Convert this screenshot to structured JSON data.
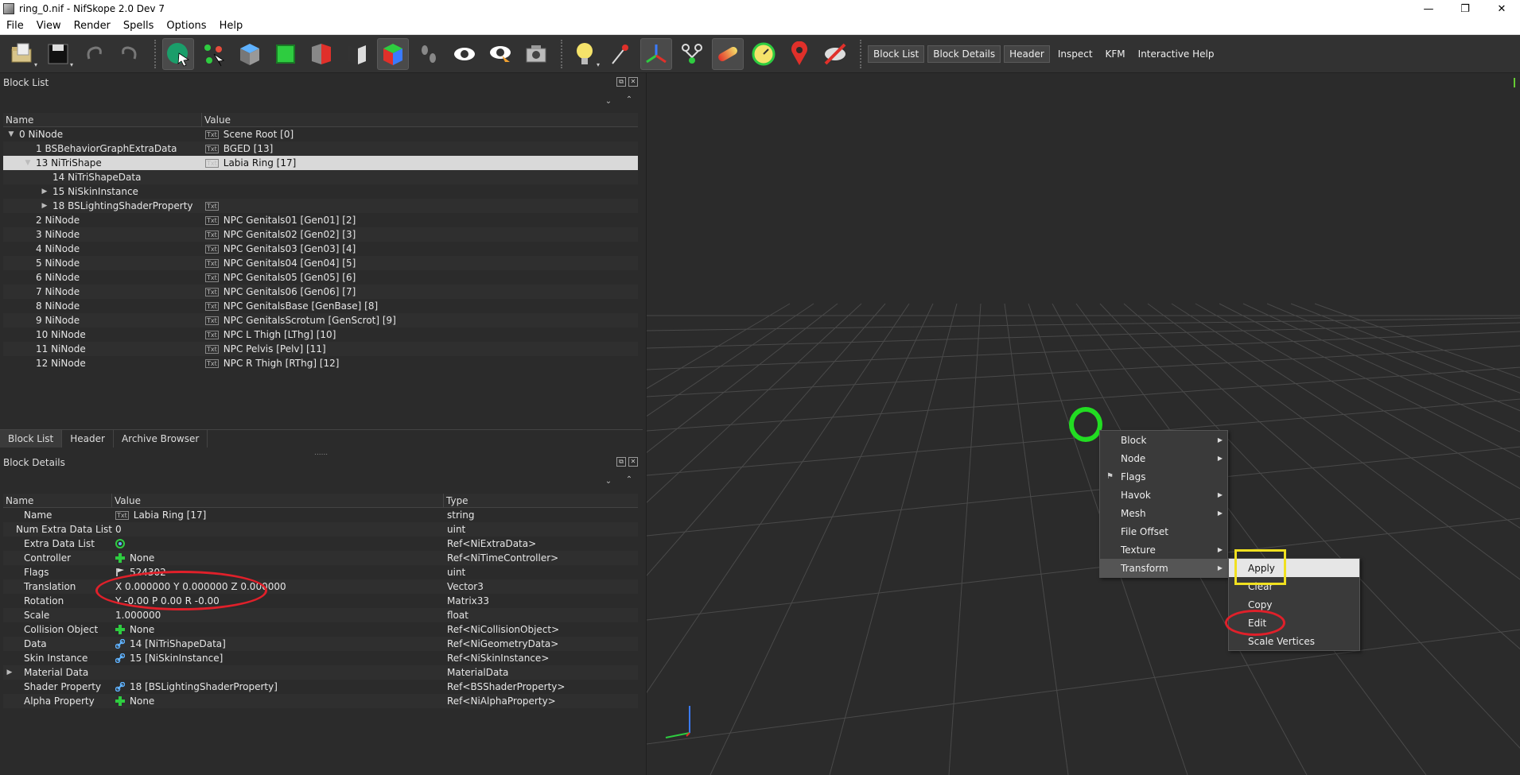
{
  "window": {
    "title": "ring_0.nif - NifSkope 2.0 Dev 7",
    "controls": [
      "—",
      "❐",
      "✕"
    ]
  },
  "menubar": [
    "File",
    "View",
    "Render",
    "Spells",
    "Options",
    "Help"
  ],
  "toolbar": {
    "text_buttons": [
      "Block List",
      "Block Details",
      "Header",
      "Inspect",
      "KFM",
      "Interactive Help"
    ]
  },
  "block_list": {
    "title": "Block List",
    "columns": [
      "Name",
      "Value"
    ],
    "rows": [
      {
        "indent": 0,
        "arrow": "▼",
        "name": "0 NiNode",
        "icon": "txt",
        "value": "Scene Root [0]"
      },
      {
        "indent": 1,
        "arrow": "",
        "name": "1 BSBehaviorGraphExtraData",
        "icon": "txt",
        "value": "BGED [13]"
      },
      {
        "indent": 1,
        "arrow": "▼",
        "name": "13 NiTriShape",
        "icon": "txt",
        "value": "Labia Ring [17]",
        "selected": true
      },
      {
        "indent": 2,
        "arrow": "",
        "name": "14 NiTriShapeData",
        "icon": "",
        "value": ""
      },
      {
        "indent": 2,
        "arrow": "▶",
        "name": "15 NiSkinInstance",
        "icon": "",
        "value": ""
      },
      {
        "indent": 2,
        "arrow": "▶",
        "name": "18 BSLightingShaderProperty",
        "icon": "txt",
        "value": ""
      },
      {
        "indent": 1,
        "arrow": "",
        "name": "2 NiNode",
        "icon": "txt",
        "value": "NPC Genitals01 [Gen01] [2]"
      },
      {
        "indent": 1,
        "arrow": "",
        "name": "3 NiNode",
        "icon": "txt",
        "value": "NPC Genitals02 [Gen02] [3]"
      },
      {
        "indent": 1,
        "arrow": "",
        "name": "4 NiNode",
        "icon": "txt",
        "value": "NPC Genitals03 [Gen03] [4]"
      },
      {
        "indent": 1,
        "arrow": "",
        "name": "5 NiNode",
        "icon": "txt",
        "value": "NPC Genitals04 [Gen04] [5]"
      },
      {
        "indent": 1,
        "arrow": "",
        "name": "6 NiNode",
        "icon": "txt",
        "value": "NPC Genitals05 [Gen05] [6]"
      },
      {
        "indent": 1,
        "arrow": "",
        "name": "7 NiNode",
        "icon": "txt",
        "value": "NPC Genitals06 [Gen06] [7]"
      },
      {
        "indent": 1,
        "arrow": "",
        "name": "8 NiNode",
        "icon": "txt",
        "value": "NPC GenitalsBase [GenBase] [8]"
      },
      {
        "indent": 1,
        "arrow": "",
        "name": "9 NiNode",
        "icon": "txt",
        "value": "NPC GenitalsScrotum [GenScrot] [9]"
      },
      {
        "indent": 1,
        "arrow": "",
        "name": "10 NiNode",
        "icon": "txt",
        "value": "NPC L Thigh [LThg] [10]"
      },
      {
        "indent": 1,
        "arrow": "",
        "name": "11 NiNode",
        "icon": "txt",
        "value": "NPC Pelvis [Pelv] [11]"
      },
      {
        "indent": 1,
        "arrow": "",
        "name": "12 NiNode",
        "icon": "txt",
        "value": "NPC R Thigh [RThg] [12]"
      }
    ]
  },
  "tabs": [
    "Block List",
    "Header",
    "Archive Browser"
  ],
  "block_details": {
    "title": "Block Details",
    "columns": [
      "Name",
      "Value",
      "Type"
    ],
    "rows": [
      {
        "arrow": "",
        "name": "Name",
        "icon": "txt",
        "value": "Labia Ring [17]",
        "type": "string"
      },
      {
        "arrow": "",
        "name": "Num Extra Data List",
        "icon": "",
        "value": "0",
        "type": "uint"
      },
      {
        "arrow": "",
        "name": "Extra Data List",
        "icon": "link-green",
        "value": "",
        "type": "Ref<NiExtraData>"
      },
      {
        "arrow": "",
        "name": "Controller",
        "icon": "plus",
        "value": "None",
        "type": "Ref<NiTimeController>"
      },
      {
        "arrow": "",
        "name": "Flags",
        "icon": "flag",
        "value": "524302",
        "type": "uint"
      },
      {
        "arrow": "",
        "name": "Translation",
        "icon": "",
        "value": "X 0.000000 Y 0.000000 Z 0.000000",
        "type": "Vector3"
      },
      {
        "arrow": "",
        "name": "Rotation",
        "icon": "",
        "value": "Y -0.00 P 0.00 R -0.00",
        "type": "Matrix33"
      },
      {
        "arrow": "",
        "name": "Scale",
        "icon": "",
        "value": "1.000000",
        "type": "float"
      },
      {
        "arrow": "",
        "name": "Collision Object",
        "icon": "plus",
        "value": "None",
        "type": "Ref<NiCollisionObject>"
      },
      {
        "arrow": "",
        "name": "Data",
        "icon": "link",
        "value": "14 [NiTriShapeData]",
        "type": "Ref<NiGeometryData>"
      },
      {
        "arrow": "",
        "name": "Skin Instance",
        "icon": "link",
        "value": "15 [NiSkinInstance]",
        "type": "Ref<NiSkinInstance>"
      },
      {
        "arrow": "▶",
        "name": "Material Data",
        "icon": "",
        "value": "",
        "type": "MaterialData"
      },
      {
        "arrow": "",
        "name": "Shader Property",
        "icon": "link",
        "value": "18 [BSLightingShaderProperty]",
        "type": "Ref<BSShaderProperty>"
      },
      {
        "arrow": "",
        "name": "Alpha Property",
        "icon": "plus",
        "value": "None",
        "type": "Ref<NiAlphaProperty>"
      }
    ]
  },
  "context_menu": {
    "items": [
      {
        "label": "Block",
        "submenu": true
      },
      {
        "label": "Node",
        "submenu": true
      },
      {
        "label": "Flags",
        "submenu": false,
        "lead": "flag"
      },
      {
        "label": "Havok",
        "submenu": true
      },
      {
        "label": "Mesh",
        "submenu": true
      },
      {
        "label": "File Offset",
        "submenu": false
      },
      {
        "label": "Texture",
        "submenu": true
      },
      {
        "label": "Transform",
        "submenu": true,
        "highlighted": true
      }
    ]
  },
  "transform_submenu": {
    "items": [
      {
        "label": "Apply",
        "highlighted": true
      },
      {
        "label": "Clear"
      },
      {
        "label": "Copy"
      },
      {
        "label": "Edit"
      },
      {
        "label": "Scale Vertices"
      }
    ]
  },
  "colors": {
    "background": "#2b2b2b",
    "selection": "#d9d9d9",
    "annotation_red": "#e0202a",
    "annotation_yellow": "#f0e020",
    "annotation_green": "#22dd22"
  }
}
